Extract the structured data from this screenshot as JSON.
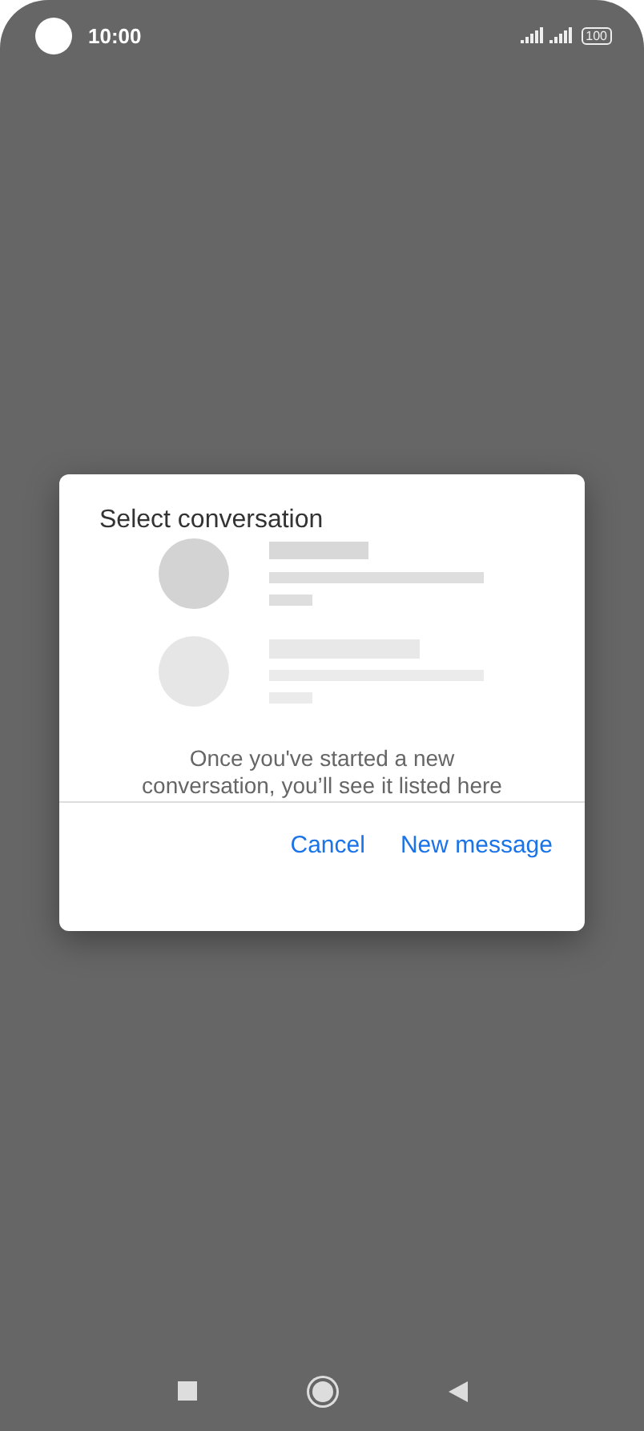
{
  "status_bar": {
    "time": "10:00",
    "battery": "100"
  },
  "dialog": {
    "title": "Select conversation",
    "message": "Once you've started a new conversation, you’ll see it listed here",
    "buttons": [
      "Cancel",
      "New message"
    ]
  }
}
